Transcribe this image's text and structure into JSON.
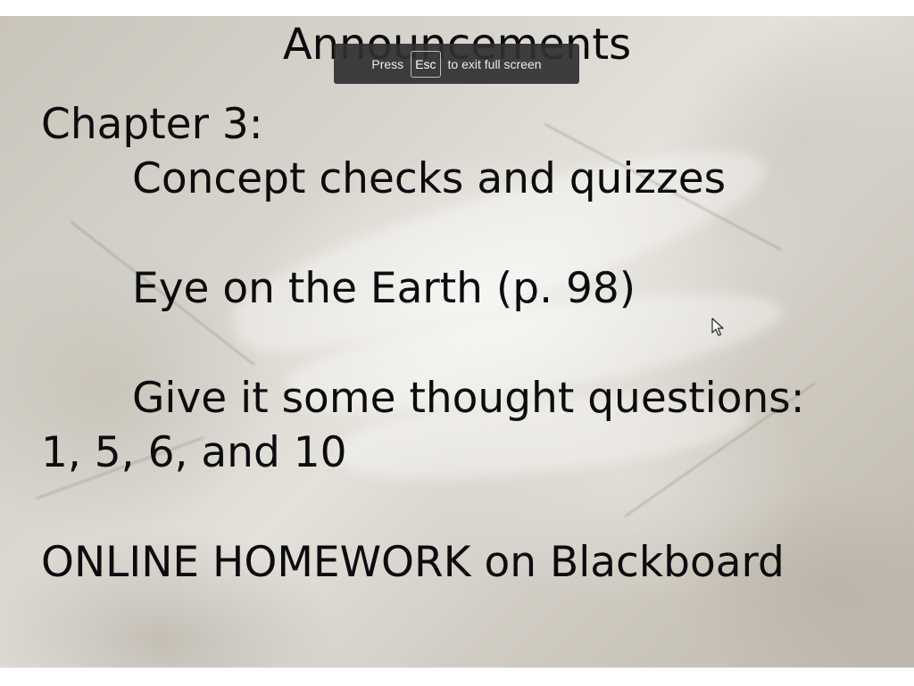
{
  "slide": {
    "title": "Announcements",
    "lines": [
      "Chapter 3:",
      "Concept checks and quizzes",
      "Eye on the Earth (p. 98)",
      "Give it some thought questions:",
      "1, 5, 6, and 10",
      "ONLINE HOMEWORK on Blackboard"
    ]
  },
  "fullscreen_notice": {
    "prefix": "Press",
    "key": "Esc",
    "suffix": "to exit full screen"
  },
  "icons": {
    "cursor": "mouse-pointer-icon"
  },
  "colors": {
    "text": "#0c0c0c",
    "notice_bg": "#303030"
  }
}
